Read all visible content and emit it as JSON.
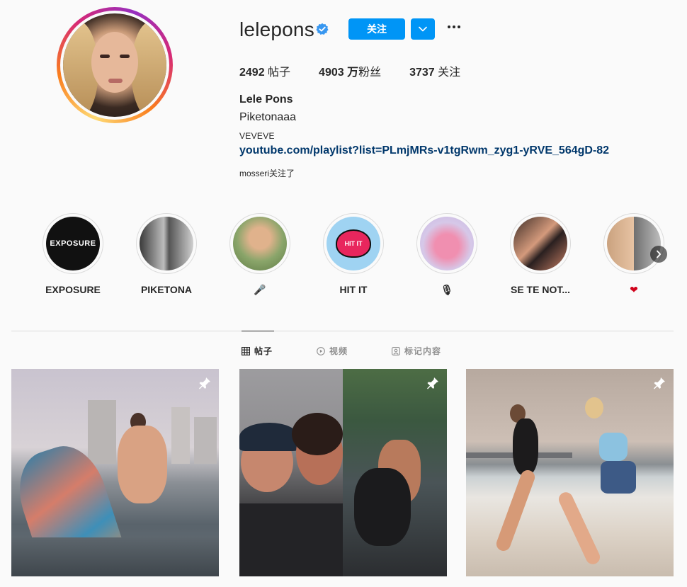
{
  "profile": {
    "username": "lelepons",
    "follow_label": "关注",
    "stats": {
      "posts_count": "2492",
      "posts_label": " 帖子",
      "followers_count": "4903 万",
      "followers_label": "粉丝",
      "following_count": "3737",
      "following_label": " 关注"
    },
    "full_name": "Lele Pons",
    "bio": "Piketonaaa",
    "category": "VEVEVE",
    "link": "youtube.com/playlist?list=PLmjMRs-v1tgRwm_zyg1-yRVE_564gD-82",
    "followed_by": "mosseri",
    "followed_by_suffix": "关注了"
  },
  "highlights": [
    {
      "label": "EXPOSURE",
      "cover_text": "EXPOSURE"
    },
    {
      "label": "PIKETONA"
    },
    {
      "label": "🎤"
    },
    {
      "label": "HIT IT",
      "cover_text": "HIT IT"
    },
    {
      "label": "🎙"
    },
    {
      "label": "SE TE NOT..."
    },
    {
      "label": "❤"
    }
  ],
  "tabs": [
    {
      "label": "帖子",
      "icon": "grid-icon",
      "active": true
    },
    {
      "label": "视频",
      "icon": "play-icon",
      "active": false
    },
    {
      "label": "标记内容",
      "icon": "tagged-icon",
      "active": false
    }
  ],
  "posts": [
    {
      "pinned": true
    },
    {
      "pinned": true
    },
    {
      "pinned": true
    }
  ],
  "colors": {
    "accent": "#0095f6",
    "link": "#00376b",
    "text": "#262626",
    "muted": "#8e8e8e",
    "border": "#dbdbdb",
    "background": "#fafafa"
  }
}
